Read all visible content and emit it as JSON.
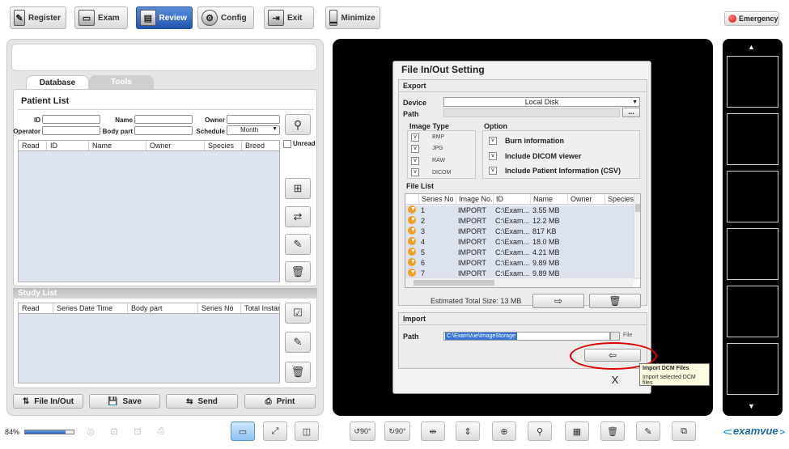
{
  "topbar": {
    "buttons": [
      {
        "label": "Register",
        "icon": "register-icon"
      },
      {
        "label": "Exam",
        "icon": "exam-icon"
      },
      {
        "label": "Review",
        "icon": "review-icon"
      },
      {
        "label": "Config",
        "icon": "gear-icon"
      },
      {
        "label": "Exit",
        "icon": "exit-icon"
      },
      {
        "label": "Minimize",
        "icon": "minimize-icon"
      }
    ],
    "active": "Review",
    "emergency": "Emergency"
  },
  "left": {
    "tabs": [
      "Database",
      "Tools"
    ],
    "patient_list_title": "Patient List",
    "fields": {
      "id": "ID",
      "name": "Name",
      "owner": "Owner",
      "operator": "Operator",
      "body_part": "Body part",
      "schedule": "Schedule",
      "schedule_value": "Month"
    },
    "unread": "Unread",
    "patient_columns": [
      "Read",
      "ID",
      "Name",
      "Owner",
      "Species",
      "Breed"
    ],
    "study_list_title": "Study List",
    "study_columns": [
      "Read",
      "Series Date Time",
      "Body part",
      "Series No",
      "Total Instan"
    ],
    "bottom_buttons": [
      "File In/Out",
      "Save",
      "Send",
      "Print"
    ]
  },
  "dialog": {
    "title": "File In/Out Setting",
    "export_title": "Export",
    "device_label": "Device",
    "device_value": "Local Disk",
    "path_label": "Path",
    "path_browse": "...",
    "image_type_title": "Image Type",
    "image_types": [
      "BMP",
      "JPG",
      "RAW",
      "DICOM"
    ],
    "option_title": "Option",
    "options": [
      "Burn information",
      "Include DICOM viewer",
      "Include Patient Information (CSV)"
    ],
    "check_mark": "v",
    "file_list_title": "File List",
    "file_columns": [
      "Series No",
      "Image No.",
      "ID",
      "Name",
      "Owner",
      "Species"
    ],
    "files": [
      {
        "series": "1",
        "image": "IMPORT",
        "id": "C:\\Exam...",
        "name": "3.55 MB"
      },
      {
        "series": "2",
        "image": "IMPORT",
        "id": "C:\\Exam...",
        "name": "12.2 MB"
      },
      {
        "series": "3",
        "image": "IMPORT",
        "id": "C:\\Exam...",
        "name": "817 KB"
      },
      {
        "series": "4",
        "image": "IMPORT",
        "id": "C:\\Exam...",
        "name": "18.0 MB"
      },
      {
        "series": "5",
        "image": "IMPORT",
        "id": "C:\\Exam...",
        "name": "4.21 MB"
      },
      {
        "series": "6",
        "image": "IMPORT",
        "id": "C:\\Exam...",
        "name": "9.89 MB"
      },
      {
        "series": "7",
        "image": "IMPORT",
        "id": "C:\\Exam...",
        "name": "9.89 MB"
      }
    ],
    "estimated_total": "Estimated Total Size: 13 MB",
    "import_title": "Import",
    "import_path_label": "Path",
    "import_path_value": "C:\\ExamVue\\ImageStorage",
    "import_file_toggle": "File",
    "close_label": "X",
    "tooltip_title": "Import DCM Files",
    "tooltip_body": "Import selected DCM files",
    "highlight_color": "#e00000"
  },
  "bottombar": {
    "zoom_level": "84%",
    "zoom_progress": 0.84,
    "rotate_left": "90°",
    "rotate_right": "90°",
    "brand": "examvue"
  }
}
